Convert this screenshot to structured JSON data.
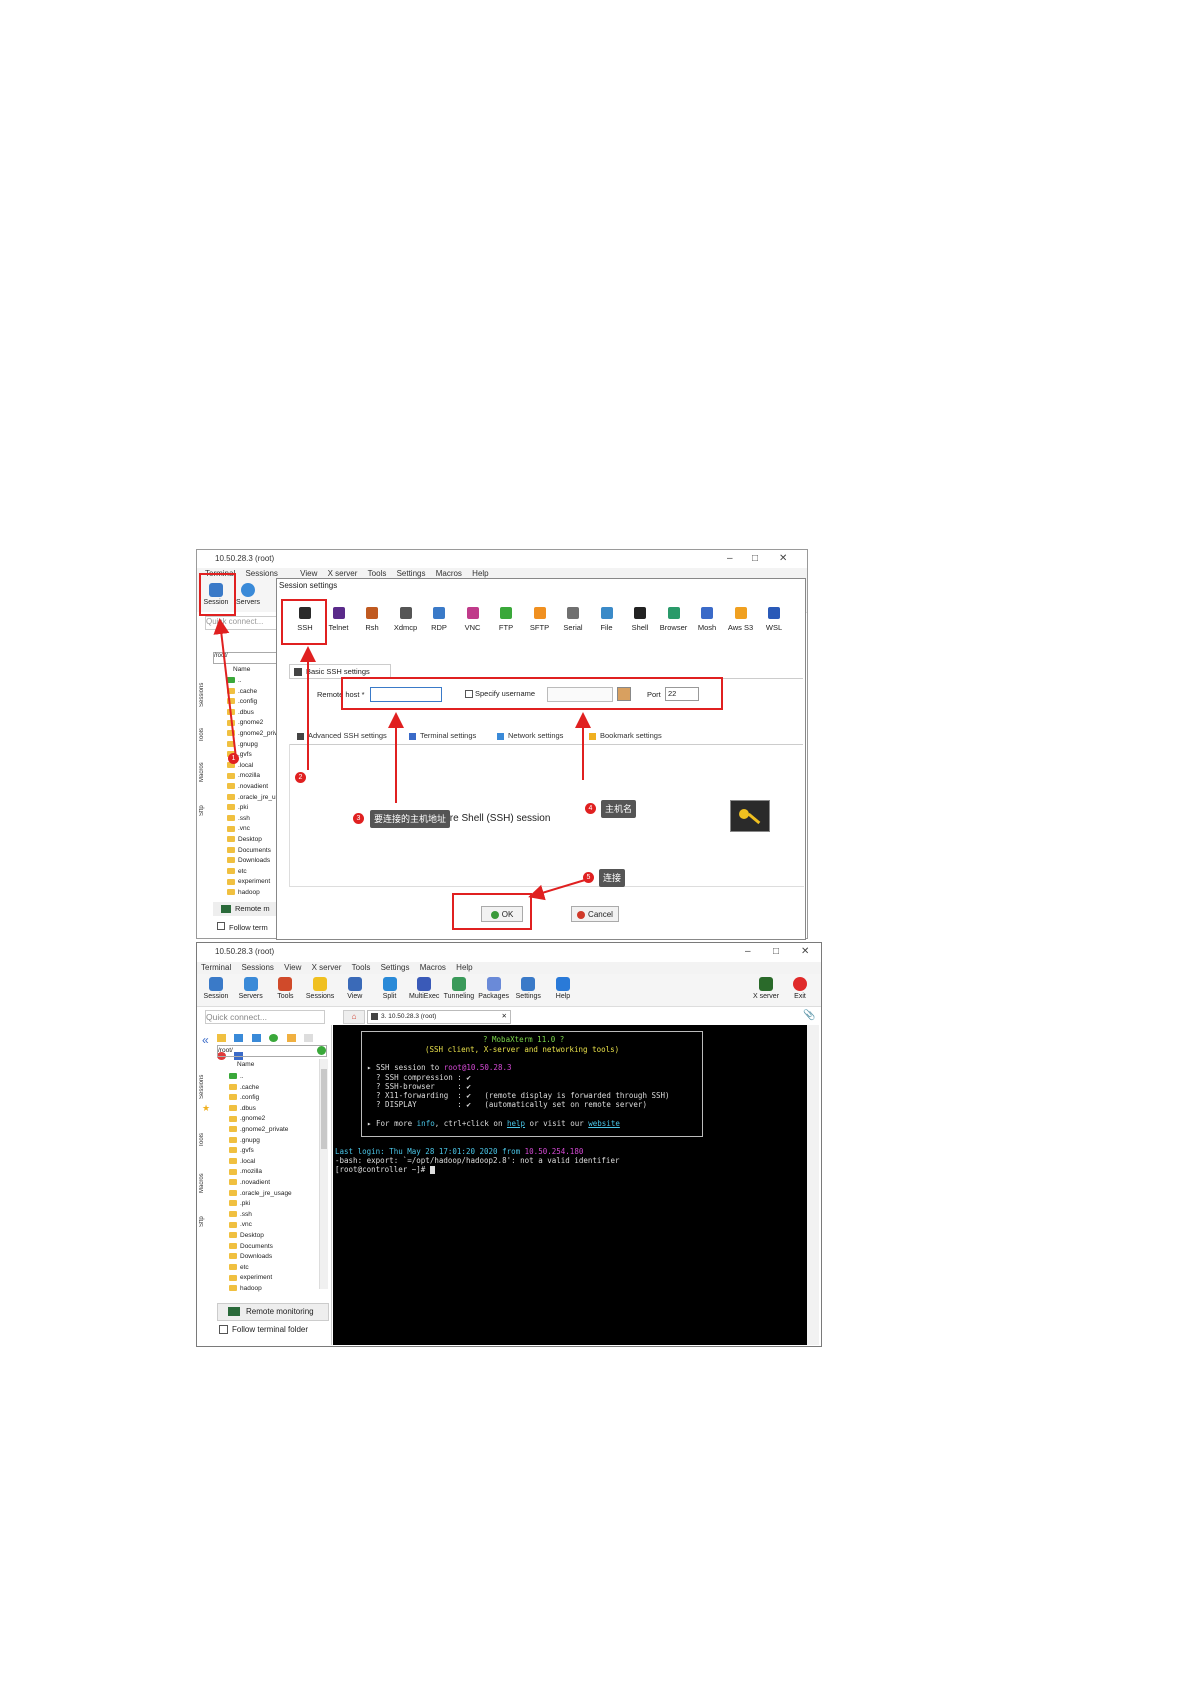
{
  "top_window": {
    "title": "10.50.28.3 (root)",
    "menu": [
      "Terminal",
      "Sessions",
      "View",
      "X server",
      "Tools",
      "Settings",
      "Macros",
      "Help"
    ],
    "toolbar": {
      "session": "Session",
      "servers": "Servers"
    },
    "quick_connect_placeholder": "Quick connect...",
    "path": "/root/",
    "tree_header": "Name",
    "files": [
      "..",
      ".cache",
      ".config",
      ".dbus",
      ".gnome2",
      ".gnome2_priv",
      ".gnupg",
      ".gvfs",
      ".local",
      ".mozilla",
      ".novadient",
      ".oracle_jre_u",
      ".pki",
      ".ssh",
      ".vnc",
      "Desktop",
      "Documents",
      "Downloads",
      "etc",
      "experiment",
      "hadoop"
    ],
    "vtabs": [
      "Sessions",
      "Tools",
      "Macros",
      "Sftp"
    ],
    "remote_label": "Remote m",
    "follow_label": "Follow term"
  },
  "dialog": {
    "title": "Session settings",
    "protocols": [
      {
        "label": "SSH",
        "icon": "ssh-icon",
        "color": "#2a2a2a"
      },
      {
        "label": "Telnet",
        "icon": "telnet-icon",
        "color": "#5a2a8a"
      },
      {
        "label": "Rsh",
        "icon": "rsh-icon",
        "color": "#c05a20"
      },
      {
        "label": "Xdmcp",
        "icon": "xdmcp-icon",
        "color": "#555555"
      },
      {
        "label": "RDP",
        "icon": "rdp-icon",
        "color": "#3a7ac8"
      },
      {
        "label": "VNC",
        "icon": "vnc-icon",
        "color": "#c03a8a"
      },
      {
        "label": "FTP",
        "icon": "ftp-icon",
        "color": "#3aa83a"
      },
      {
        "label": "SFTP",
        "icon": "sftp-icon",
        "color": "#f09020"
      },
      {
        "label": "Serial",
        "icon": "serial-icon",
        "color": "#707070"
      },
      {
        "label": "File",
        "icon": "file-icon",
        "color": "#3a8ac8"
      },
      {
        "label": "Shell",
        "icon": "shell-icon",
        "color": "#222222"
      },
      {
        "label": "Browser",
        "icon": "browser-icon",
        "color": "#2a9a6a"
      },
      {
        "label": "Mosh",
        "icon": "mosh-icon",
        "color": "#3a6ac8"
      },
      {
        "label": "Aws S3",
        "icon": "aws-s3-icon",
        "color": "#f0a020"
      },
      {
        "label": "WSL",
        "icon": "wsl-icon",
        "color": "#2a5ab8"
      }
    ],
    "basic_tab": "Basic SSH settings",
    "remote_host_label": "Remote host *",
    "specify_username_label": "Specify username",
    "port_label": "Port",
    "port_value": "22",
    "sub_tabs": [
      "Advanced SSH settings",
      "Terminal settings",
      "Network settings",
      "Bookmark settings"
    ],
    "session_desc": "Secure Shell (SSH) session",
    "ok_label": "OK",
    "cancel_label": "Cancel"
  },
  "annotations": {
    "n1": "1",
    "n2": "2",
    "n3": "3",
    "n4": "4",
    "n5": "5",
    "c3": "要连接的主机地址",
    "c4": "主机名",
    "c5": "连接"
  },
  "bottom_window": {
    "title": "10.50.28.3 (root)",
    "menu": [
      "Terminal",
      "Sessions",
      "View",
      "X server",
      "Tools",
      "Settings",
      "Macros",
      "Help"
    ],
    "toolbar": [
      {
        "label": "Session",
        "icon": "session-icon",
        "color": "#3a7ac8"
      },
      {
        "label": "Servers",
        "icon": "servers-icon",
        "color": "#3a8ad8"
      },
      {
        "label": "Tools",
        "icon": "tools-icon",
        "color": "#d04a2a"
      },
      {
        "label": "Sessions",
        "icon": "star-icon",
        "color": "#f0c020"
      },
      {
        "label": "View",
        "icon": "view-icon",
        "color": "#3a6ab8"
      },
      {
        "label": "Split",
        "icon": "split-icon",
        "color": "#2a8ad8"
      },
      {
        "label": "MultiExec",
        "icon": "multiexec-icon",
        "color": "#3a5ab8"
      },
      {
        "label": "Tunneling",
        "icon": "tunneling-icon",
        "color": "#3a9a5a"
      },
      {
        "label": "Packages",
        "icon": "packages-icon",
        "color": "#6a8ad8"
      },
      {
        "label": "Settings",
        "icon": "settings-icon",
        "color": "#3a7ac8"
      },
      {
        "label": "Help",
        "icon": "help-icon",
        "color": "#2a7ad8"
      }
    ],
    "xserver_label": "X server",
    "exit_label": "Exit",
    "quick_connect_placeholder": "Quick connect...",
    "path": "/root/",
    "tree_header": "Name",
    "files": [
      "..",
      ".cache",
      ".config",
      ".dbus",
      ".gnome2",
      ".gnome2_private",
      ".gnupg",
      ".gvfs",
      ".local",
      ".mozilla",
      ".novadient",
      ".oracle_jre_usage",
      ".pki",
      ".ssh",
      ".vnc",
      "Desktop",
      "Documents",
      "Downloads",
      "etc",
      "experiment",
      "hadoop"
    ],
    "vtabs": [
      "Sessions",
      "Tools",
      "Macros",
      "Sftp"
    ],
    "tab_label": "3. 10.50.28.3 (root)",
    "remote_monitoring": "Remote monitoring",
    "follow_label": "Follow terminal folder",
    "terminal": {
      "banner_title": "? MobaXterm 11.0 ?",
      "banner_sub": "(SSH client, X-server and networking tools)",
      "ssh_session_prefix": "▸ SSH session to ",
      "ssh_session_target": "root@10.50.28.3",
      "line_compression": "  ? SSH compression : ✔",
      "line_browser": "  ? SSH-browser     : ✔",
      "line_x11": "  ? X11-forwarding  : ✔   (remote display is forwarded through SSH)",
      "line_display": "  ? DISPLAY         : ✔   (automatically set on remote server)",
      "more_prefix": "▸ For more ",
      "more_info": "info",
      "more_mid": ", ctrl+click on ",
      "more_help": "help",
      "more_mid2": " or visit our ",
      "more_website": "website",
      "last_login_prefix": "Last login: Thu May 28 17:01:20 2020 from ",
      "last_login_ip": "10.50.254.180",
      "bash_line": "-bash: export: `=/opt/hadoop/hadoop2.8': not a valid identifier",
      "prompt": "[root@controller ~]# "
    }
  }
}
